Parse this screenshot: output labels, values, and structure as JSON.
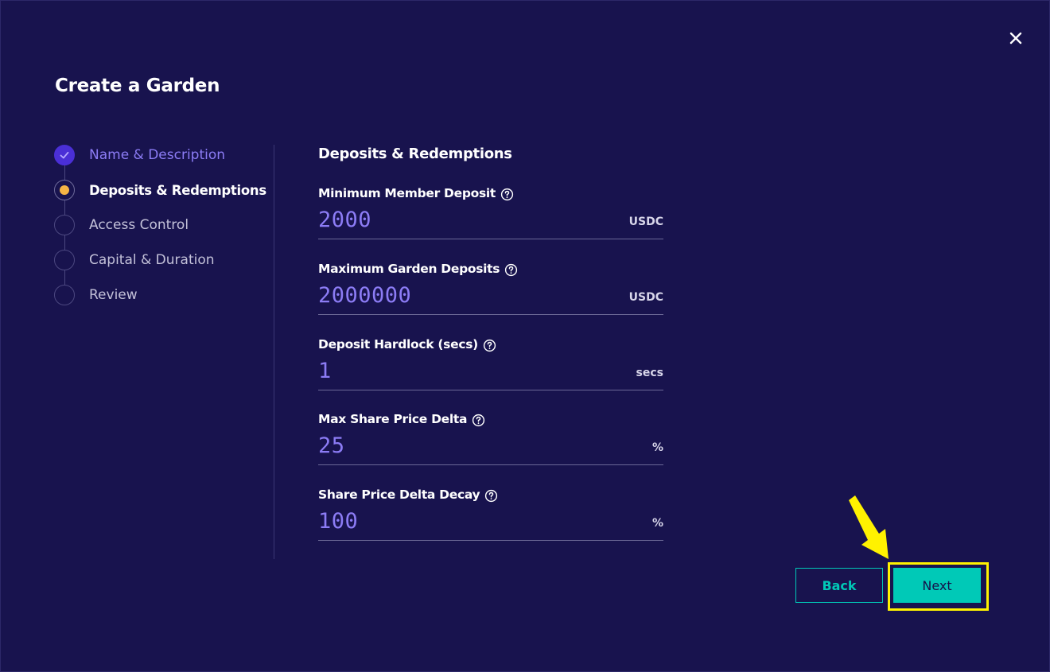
{
  "modal": {
    "title": "Create a Garden"
  },
  "steps": [
    {
      "label": "Name & Description",
      "state": "done"
    },
    {
      "label": "Deposits & Redemptions",
      "state": "active"
    },
    {
      "label": "Access Control",
      "state": "pending"
    },
    {
      "label": "Capital & Duration",
      "state": "pending"
    },
    {
      "label": "Review",
      "state": "pending"
    }
  ],
  "form": {
    "section_title": "Deposits & Redemptions",
    "fields": [
      {
        "label": "Minimum Member Deposit",
        "value": "2000",
        "unit": "USDC"
      },
      {
        "label": "Maximum Garden Deposits",
        "value": "2000000",
        "unit": "USDC"
      },
      {
        "label": "Deposit Hardlock (secs)",
        "value": "1",
        "unit": "secs"
      },
      {
        "label": "Max Share Price Delta",
        "value": "25",
        "unit": "%"
      },
      {
        "label": "Share Price Delta Decay",
        "value": "100",
        "unit": "%"
      }
    ]
  },
  "buttons": {
    "back_label": "Back",
    "next_label": "Next"
  },
  "colors": {
    "background": "#18134e",
    "accent_teal": "#00c9b7",
    "accent_purple": "#8c7cf5",
    "step_done": "#4a2fd6",
    "step_active_dot": "#f5b445",
    "highlight": "#fff200"
  },
  "icons": {
    "close": "close-icon",
    "help": "help-circle-icon",
    "check": "check-icon",
    "pointer": "arrow-pointer-icon"
  }
}
